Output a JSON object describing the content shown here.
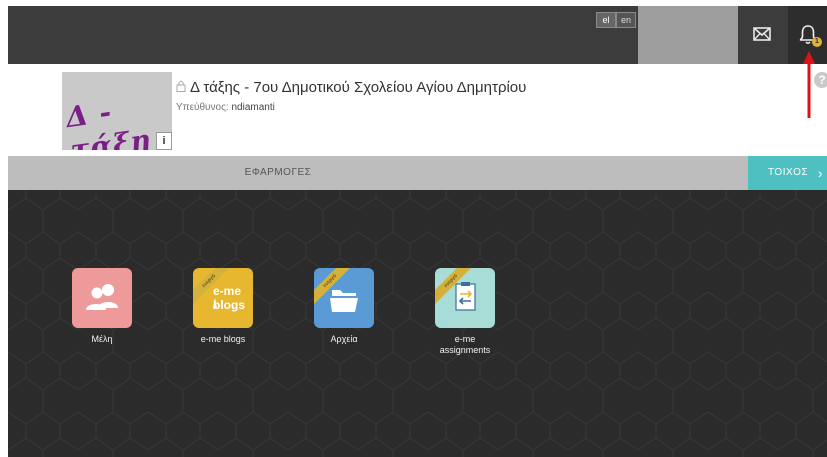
{
  "topbar": {
    "lang_el": "el",
    "lang_en": "en",
    "notification_count": "1",
    "colors": {
      "bar": "#3c3c3c",
      "badge": "#e2b13c"
    }
  },
  "header": {
    "logo_text": "Δ - τάξη",
    "info_label": "i",
    "title": "Δ τάξης - 7ου Δημοτικού Σχολείου Αγίου Δημητρίου",
    "owner_label": "Υπεύθυνος:",
    "owner_name": "ndiamanti",
    "help_label": "?"
  },
  "tabs": {
    "apps_label": "ΕΦΑΡΜΟΓΕΣ",
    "wall_label": "ΤΟΙΧΟΣ",
    "wall_color": "#4fc0c2"
  },
  "apps": [
    {
      "label": "Μέλη",
      "line2": "",
      "icon": "members-icon",
      "color": "#ef9a9a",
      "ribbon": ""
    },
    {
      "label": "e-me blogs",
      "line2": "",
      "icon": "blogs-icon",
      "color": "#e8b730",
      "ribbon": "ενεργό",
      "tile_text_1": "e-me",
      "tile_text_2": "blogs"
    },
    {
      "label": "Αρχεία",
      "line2": "",
      "icon": "folder-icon",
      "color": "#5b9bd5",
      "ribbon": "ενεργό"
    },
    {
      "label": "e-me",
      "line2": "assignments",
      "icon": "assignments-icon",
      "color": "#a8dcd6",
      "ribbon": "ενεργό"
    }
  ]
}
